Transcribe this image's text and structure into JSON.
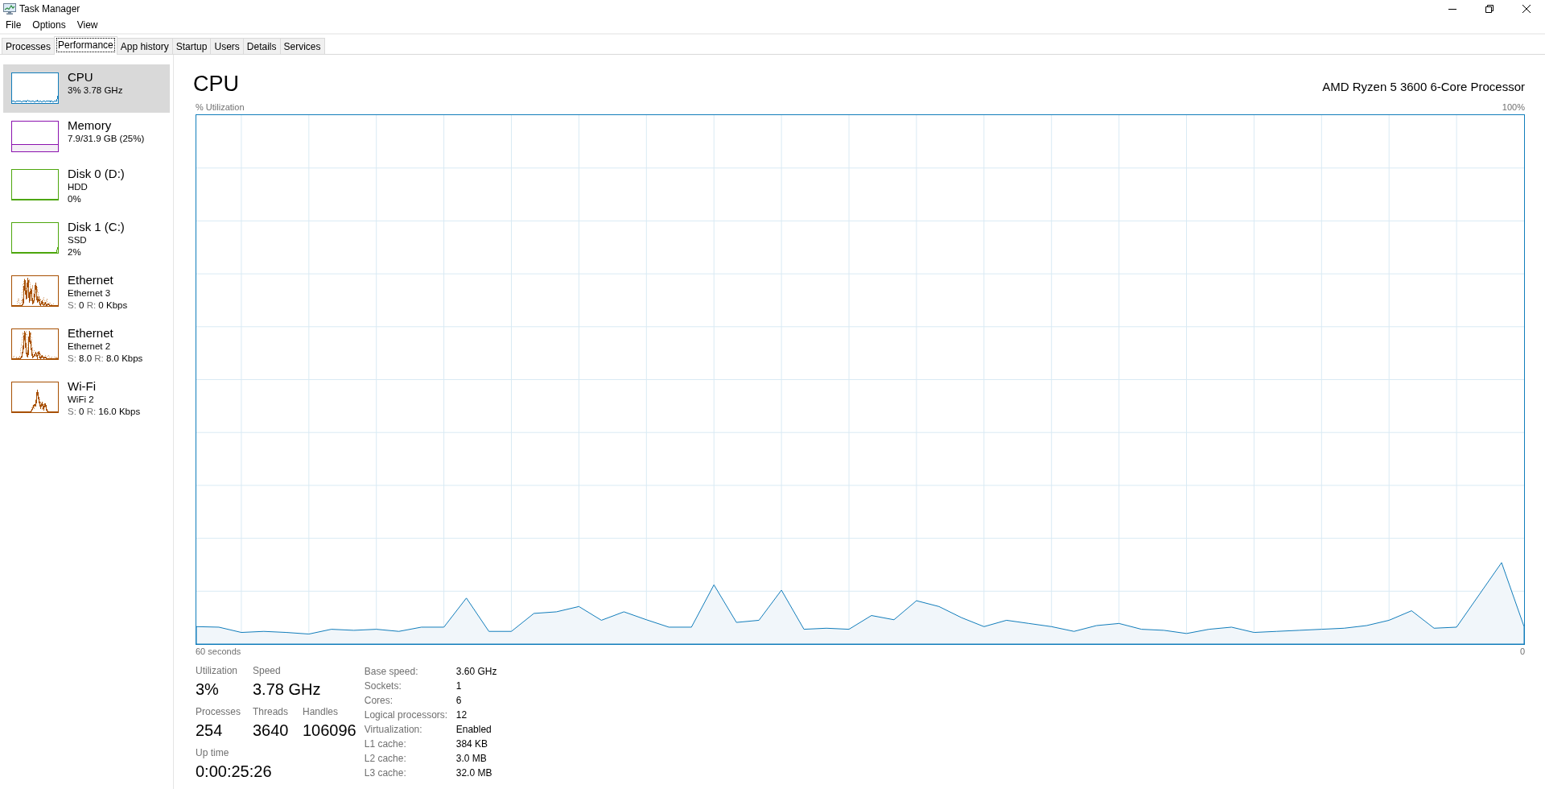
{
  "window": {
    "title": "Task Manager"
  },
  "menu": [
    "File",
    "Options",
    "View"
  ],
  "tabs": [
    {
      "label": "Processes",
      "selected": false
    },
    {
      "label": "Performance",
      "selected": true
    },
    {
      "label": "App history",
      "selected": false
    },
    {
      "label": "Startup",
      "selected": false
    },
    {
      "label": "Users",
      "selected": false
    },
    {
      "label": "Details",
      "selected": false
    },
    {
      "label": "Services",
      "selected": false
    }
  ],
  "sidebar": {
    "items": [
      {
        "kind": "cpu",
        "title": "CPU",
        "color": "#117dbb",
        "selected": true,
        "lines": [
          "3% 3.78 GHz"
        ]
      },
      {
        "kind": "memory",
        "title": "Memory",
        "color": "#8b12ae",
        "selected": false,
        "lines": [
          "7.9/31.9 GB (25%)"
        ]
      },
      {
        "kind": "disk",
        "title": "Disk 0 (D:)",
        "color": "#4da60c",
        "selected": false,
        "lines": [
          "HDD",
          "0%"
        ]
      },
      {
        "kind": "disk",
        "title": "Disk 1 (C:)",
        "color": "#4da60c",
        "selected": false,
        "lines": [
          "SSD",
          "2%"
        ]
      },
      {
        "kind": "network",
        "title": "Ethernet",
        "color": "#a74f01",
        "selected": false,
        "lines": [
          "Ethernet 3"
        ],
        "rates": [
          {
            "label": "S:",
            "value": "0"
          },
          {
            "label": "R:",
            "value": "0 Kbps"
          }
        ]
      },
      {
        "kind": "network",
        "title": "Ethernet",
        "color": "#a74f01",
        "selected": false,
        "lines": [
          "Ethernet 2"
        ],
        "rates": [
          {
            "label": "S:",
            "value": "8.0"
          },
          {
            "label": "R:",
            "value": "8.0 Kbps"
          }
        ]
      },
      {
        "kind": "network",
        "title": "Wi-Fi",
        "color": "#a74f01",
        "selected": false,
        "lines": [
          "WiFi 2"
        ],
        "rates": [
          {
            "label": "S:",
            "value": "0"
          },
          {
            "label": "R:",
            "value": "16.0 Kbps"
          }
        ]
      }
    ]
  },
  "panel": {
    "title": "CPU",
    "processor": "AMD Ryzen 5 3600 6-Core Processor",
    "graph": {
      "axis_label": "% Utilization",
      "max_label": "100%",
      "start_label": "60 seconds",
      "end_label": "0"
    },
    "stat_rows": [
      [
        {
          "label": "Utilization",
          "value": "3%"
        },
        {
          "label": "Speed",
          "value": "3.78 GHz"
        }
      ],
      [
        {
          "label": "Processes",
          "value": "254"
        },
        {
          "label": "Threads",
          "value": "3640"
        },
        {
          "label": "Handles",
          "value": "106096"
        }
      ],
      [
        {
          "label": "Up time",
          "value": "0:00:25:26"
        }
      ]
    ],
    "details": [
      {
        "label": "Base speed:",
        "value": "3.60 GHz"
      },
      {
        "label": "Sockets:",
        "value": "1"
      },
      {
        "label": "Cores:",
        "value": "6"
      },
      {
        "label": "Logical processors:",
        "value": "12"
      },
      {
        "label": "Virtualization:",
        "value": "Enabled"
      },
      {
        "label": "L1 cache:",
        "value": "384 KB"
      },
      {
        "label": "L2 cache:",
        "value": "3.0 MB"
      },
      {
        "label": "L3 cache:",
        "value": "32.0 MB"
      }
    ]
  }
}
